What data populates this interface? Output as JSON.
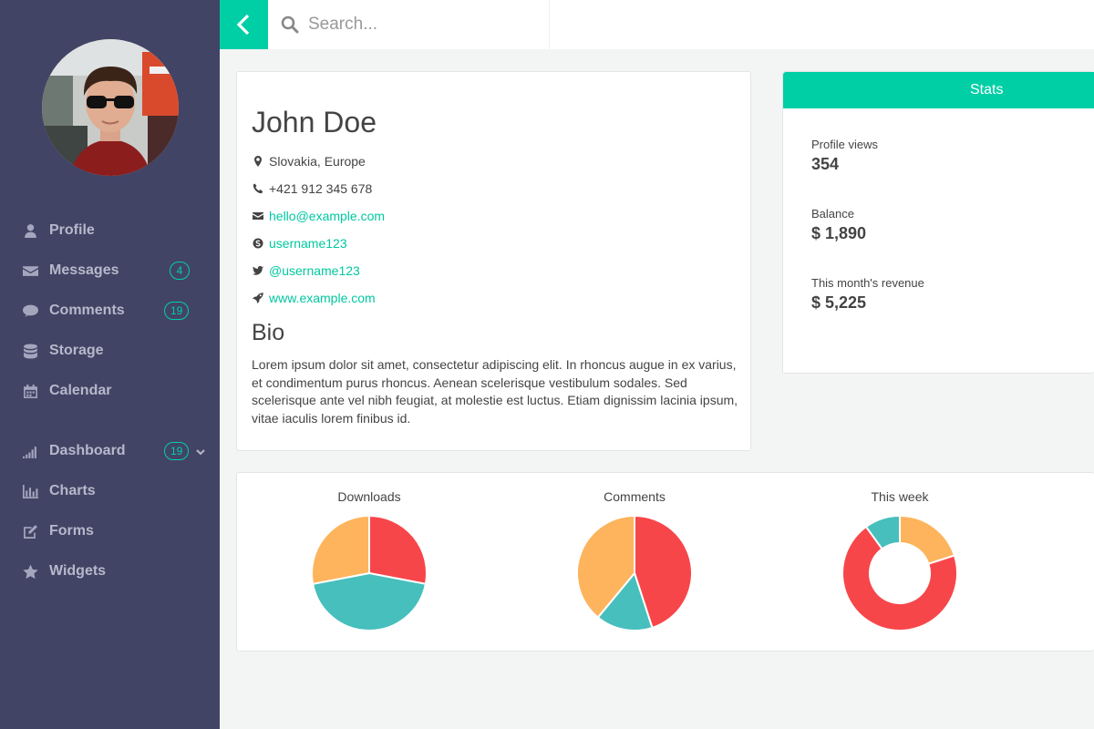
{
  "search": {
    "placeholder": "Search..."
  },
  "profile": {
    "name": "John Doe",
    "location": "Slovakia, Europe",
    "phone": "+421 912 345 678",
    "email": "hello@example.com",
    "skype": "username123",
    "twitter": "@username123",
    "website": "www.example.com",
    "bio_title": "Bio",
    "bio_text": "Lorem ipsum dolor sit amet, consectetur adipiscing elit. In rhoncus augue in ex varius, et condimentum purus rhoncus. Aenean scelerisque vestibulum sodales. Sed scelerisque ante vel nibh feugiat, at molestie est luctus. Etiam dignissim lacinia ipsum, vitae iaculis lorem finibus id."
  },
  "sidebar": {
    "items": [
      {
        "label": "Profile",
        "icon": "user-icon"
      },
      {
        "label": "Messages",
        "icon": "envelope-icon",
        "badge": "4"
      },
      {
        "label": "Comments",
        "icon": "comment-icon",
        "badge": "19"
      },
      {
        "label": "Storage",
        "icon": "database-icon"
      },
      {
        "label": "Calendar",
        "icon": "calendar-icon"
      },
      {
        "label": "Dashboard",
        "icon": "signal-icon",
        "badge": "19"
      },
      {
        "label": "Charts",
        "icon": "bar-chart-icon"
      },
      {
        "label": "Forms",
        "icon": "edit-icon"
      },
      {
        "label": "Widgets",
        "icon": "star-icon"
      }
    ]
  },
  "stats": {
    "title": "Stats",
    "items": [
      {
        "label": "Profile views",
        "value": "354"
      },
      {
        "label": "Balance",
        "value": "$ 1,890"
      },
      {
        "label": "This month's revenue",
        "value": "$ 5,225"
      }
    ]
  },
  "colors": {
    "accent": "#00cfa6",
    "sidebar": "#424465",
    "red": "#f7464a",
    "teal": "#46bfbd",
    "orange": "#fdb45c"
  },
  "chart_data": [
    {
      "type": "pie",
      "title": "Downloads",
      "values": [
        28,
        44,
        28
      ],
      "colors": [
        "#f7464a",
        "#46bfbd",
        "#fdb45c"
      ]
    },
    {
      "type": "pie",
      "title": "Comments",
      "values": [
        45,
        16,
        39
      ],
      "colors": [
        "#f7464a",
        "#46bfbd",
        "#fdb45c"
      ]
    },
    {
      "type": "doughnut",
      "title": "This week",
      "values": [
        20,
        70,
        10
      ],
      "colors": [
        "#fdb45c",
        "#f7464a",
        "#46bfbd"
      ]
    }
  ]
}
